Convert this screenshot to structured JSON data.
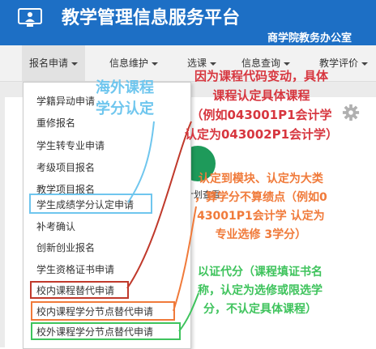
{
  "header": {
    "title": "教学管理信息服务平台",
    "college": "商学院教务办公室",
    "logo_icon": "monitor-user-icon",
    "bg_color": "#1d6fc5"
  },
  "nav": {
    "items": [
      {
        "label": "报名申请",
        "active": true
      },
      {
        "label": "信息维护"
      },
      {
        "label": "选课"
      },
      {
        "label": "信息查询"
      },
      {
        "label": "教学评价"
      }
    ]
  },
  "menu": {
    "items": [
      "学籍异动申请",
      "重修报名",
      "学生转专业申请",
      "考级项目报名",
      "教学项目报名",
      "学生成绩学分认定申请",
      "补考确认",
      "创新创业报名",
      "学生资格证书申请",
      "校内课程替代申请",
      "校内课程学分节点替代申请",
      "校外课程学分节点替代申请"
    ]
  },
  "background": {
    "plan_label": "计划查看",
    "gear_icon": "gear-icon"
  },
  "annotations": {
    "blue": {
      "color": "#6fc6ee",
      "lines": [
        "海外课程",
        "学分认定"
      ]
    },
    "red": {
      "color": "#d7363f",
      "lines": [
        "因为课程代码变动，具体",
        "课程认定具体课程",
        "（例如043001P1会计学",
        "认定为043002P1会计学）"
      ]
    },
    "orange": {
      "color": "#f07a3a",
      "lines": [
        "认定到模块、认定为大类",
        "，算学分不算绩点（例如0",
        "43001P1会计学 认定为",
        "专业选修 3学分）"
      ]
    },
    "green": {
      "color": "#3ec35c",
      "lines": [
        "以证代分（课程填证书名",
        "称，认定为选修或限选学",
        "分，不认定具体课程）"
      ]
    }
  }
}
